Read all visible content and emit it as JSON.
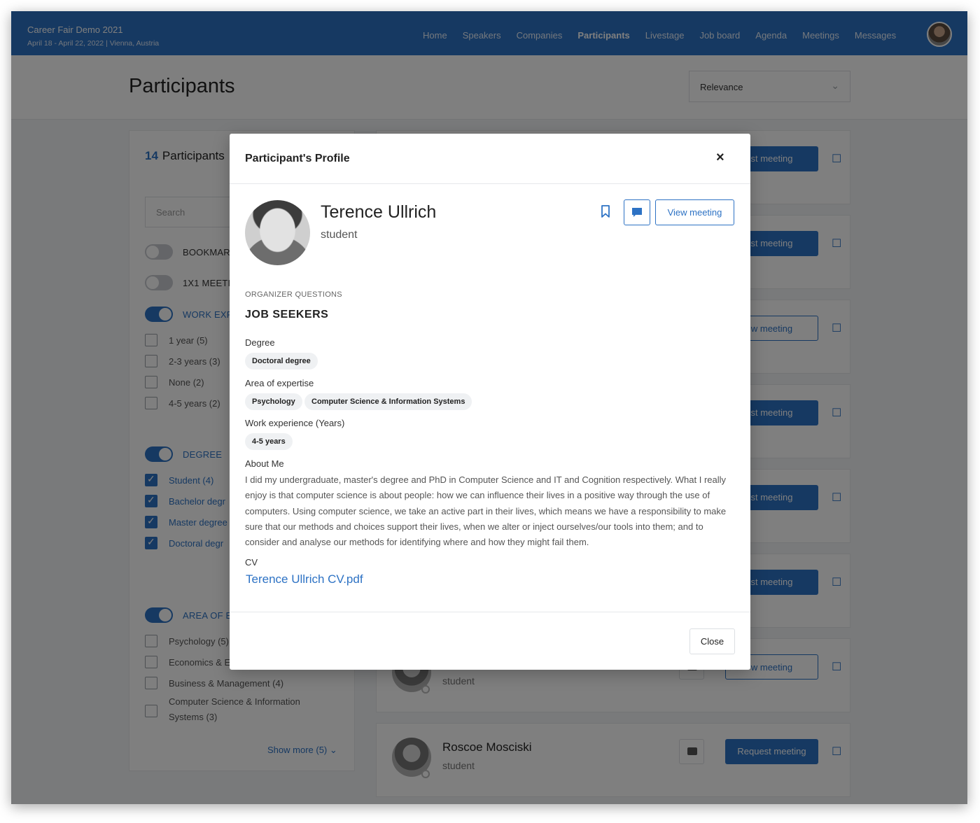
{
  "event": {
    "title": "Career Fair Demo 2021",
    "subtitle": "April 18 - April 22, 2022 | Vienna, Austria"
  },
  "nav": {
    "items": [
      "Home",
      "Speakers",
      "Companies",
      "Participants",
      "Livestage",
      "Job board",
      "Agenda",
      "Meetings",
      "Messages"
    ],
    "active": "Participants"
  },
  "page": {
    "title": "Participants",
    "sort_value": "Relevance"
  },
  "filters": {
    "count": "14",
    "count_label": "Participants",
    "search_placeholder": "Search",
    "toggles": {
      "bookmarked": "BOOKMAR",
      "meetings": "1X1 MEETIN",
      "work_experience": "WORK EXP",
      "degree": "DEGREE",
      "area": "AREA OF E"
    },
    "work_experience_options": [
      "1 year (5)",
      "2-3 years (3)",
      "None (2)",
      "4-5 years (2)"
    ],
    "degree_options": [
      "Student (4)",
      "Bachelor degr",
      "Master degree",
      "Doctoral degr"
    ],
    "area_options": [
      "Psychology (5)",
      "Economics & E",
      "Business & Management (4)",
      "Computer Science & Information Systems (3)"
    ],
    "show_more": "Show more (5)"
  },
  "list": {
    "buttons": [
      "st meeting",
      "st meeting",
      "w meeting",
      "st meeting",
      "st meeting",
      "st meeting",
      "w meeting",
      "Request meeting"
    ],
    "partial_role": "student",
    "last_card": {
      "name": "Roscoe Mosciski",
      "role": "student",
      "button": "Request meeting"
    }
  },
  "modal": {
    "title": "Participant's Profile",
    "close_symbol": "×",
    "name": "Terence Ullrich",
    "role": "student",
    "view_meeting": "View meeting",
    "organizer_label": "ORGANIZER QUESTIONS",
    "section_title": "JOB SEEKERS",
    "questions": {
      "degree_label": "Degree",
      "degree_values": [
        "Doctoral degree"
      ],
      "area_label": "Area of expertise",
      "area_values": [
        "Psychology",
        "Computer Science & Information Systems"
      ],
      "work_label": "Work experience (Years)",
      "work_values": [
        "4-5 years"
      ],
      "about_label": "About Me",
      "about_text": "I did my undergraduate, master's degree and PhD in Computer Science and IT and Cognition respectively. What I really enjoy is that computer science is about people: how we can influence their lives in a positive way through the use of computers. Using computer science, we take an active part in their lives, which means we have a responsibility to make sure that our methods and choices support their lives, when we alter or inject ourselves/our tools into them; and to consider and analyse our methods for identifying where and how they might fail them.",
      "cv_label": "CV",
      "cv_file": "Terence Ullrich CV.pdf"
    },
    "close_button": "Close"
  },
  "colors": {
    "brand": "#2d72c4",
    "overlay": "rgba(0,0,0,0.5)"
  }
}
